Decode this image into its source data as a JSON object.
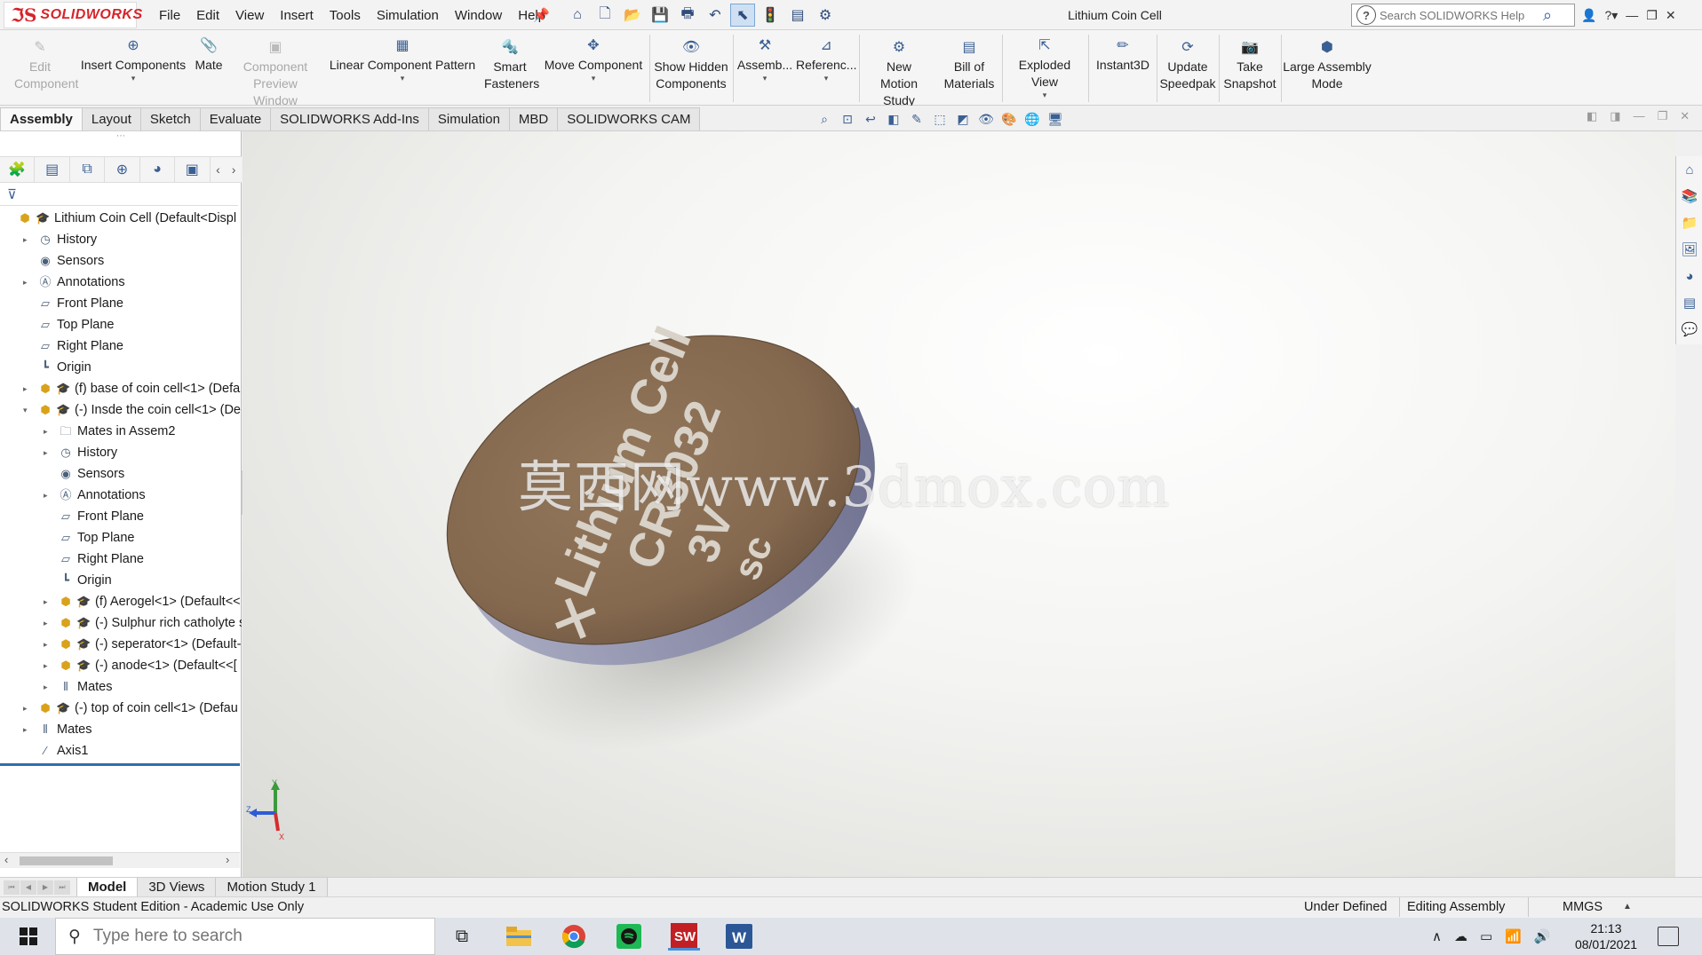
{
  "app": {
    "brand": "SOLIDWORKS",
    "document_title": "Lithium Coin Cell",
    "menu": [
      "File",
      "Edit",
      "View",
      "Insert",
      "Tools",
      "Simulation",
      "Window",
      "Help"
    ],
    "search_placeholder": "Search SOLIDWORKS Help"
  },
  "commands": {
    "edit_component": "Edit Component",
    "insert_components": "Insert Components",
    "mate": "Mate",
    "component_preview": "Component Preview Window",
    "linear_pattern": "Linear Component Pattern",
    "smart_fasteners": "Smart Fasteners",
    "move_component": "Move Component",
    "show_hidden": "Show Hidden Components",
    "assembly": "Assemb...",
    "reference": "Referenc...",
    "new_motion": "New Motion Study",
    "bom": "Bill of Materials",
    "exploded": "Exploded View",
    "instant3d": "Instant3D",
    "speedpak": "Update Speedpak",
    "snapshot": "Take Snapshot",
    "large_assembly": "Large Assembly Mode"
  },
  "tabs": [
    "Assembly",
    "Layout",
    "Sketch",
    "Evaluate",
    "SOLIDWORKS Add-Ins",
    "Simulation",
    "MBD",
    "SOLIDWORKS CAM"
  ],
  "active_tab": "Assembly",
  "tree": [
    {
      "label": "Lithium Coin Cell  (Default<Displ",
      "indent": 0,
      "icon": "assembly-icon",
      "expand": ""
    },
    {
      "label": "History",
      "indent": 1,
      "icon": "history-icon",
      "expand": "▸"
    },
    {
      "label": "Sensors",
      "indent": 1,
      "icon": "sensors-icon",
      "expand": ""
    },
    {
      "label": "Annotations",
      "indent": 1,
      "icon": "annotations-icon",
      "expand": "▸"
    },
    {
      "label": "Front Plane",
      "indent": 1,
      "icon": "plane-icon",
      "expand": ""
    },
    {
      "label": "Top Plane",
      "indent": 1,
      "icon": "plane-icon",
      "expand": ""
    },
    {
      "label": "Right Plane",
      "indent": 1,
      "icon": "plane-icon",
      "expand": ""
    },
    {
      "label": "Origin",
      "indent": 1,
      "icon": "origin-icon",
      "expand": ""
    },
    {
      "label": "(f) base of coin cell<1> (Defa",
      "indent": 1,
      "icon": "component-icon",
      "expand": "▸"
    },
    {
      "label": "(-) Insde the coin cell<1> (De",
      "indent": 1,
      "icon": "component-icon",
      "expand": "▾"
    },
    {
      "label": "Mates in Assem2",
      "indent": 2,
      "icon": "mates-folder-icon",
      "expand": "▸"
    },
    {
      "label": "History",
      "indent": 2,
      "icon": "history-icon",
      "expand": "▸"
    },
    {
      "label": "Sensors",
      "indent": 2,
      "icon": "sensors-icon",
      "expand": ""
    },
    {
      "label": "Annotations",
      "indent": 2,
      "icon": "annotations-icon",
      "expand": "▸"
    },
    {
      "label": "Front Plane",
      "indent": 2,
      "icon": "plane-icon",
      "expand": ""
    },
    {
      "label": "Top Plane",
      "indent": 2,
      "icon": "plane-icon",
      "expand": ""
    },
    {
      "label": "Right Plane",
      "indent": 2,
      "icon": "plane-icon",
      "expand": ""
    },
    {
      "label": "Origin",
      "indent": 2,
      "icon": "origin-icon",
      "expand": ""
    },
    {
      "label": "(f) Aerogel<1> (Default<<",
      "indent": 2,
      "icon": "component-icon",
      "expand": "▸"
    },
    {
      "label": "(-) Sulphur rich catholyte s",
      "indent": 2,
      "icon": "component-icon",
      "expand": "▸"
    },
    {
      "label": "(-) seperator<1> (Default-",
      "indent": 2,
      "icon": "component-icon",
      "expand": "▸"
    },
    {
      "label": "(-) anode<1> (Default<<[",
      "indent": 2,
      "icon": "component-icon",
      "expand": "▸"
    },
    {
      "label": "Mates",
      "indent": 2,
      "icon": "mates-icon",
      "expand": "▸"
    },
    {
      "label": "(-) top of coin cell<1> (Defau",
      "indent": 1,
      "icon": "component-icon",
      "expand": "▸"
    },
    {
      "label": "Mates",
      "indent": 1,
      "icon": "mates-icon",
      "expand": "▸"
    },
    {
      "label": "Axis1",
      "indent": 1,
      "icon": "axis-icon",
      "expand": ""
    }
  ],
  "model": {
    "coin_text": [
      "Lithium Cell",
      "CR3032",
      "3V",
      "sc"
    ],
    "coin_plus": "+",
    "triad": {
      "y": "Y",
      "z": "Z",
      "x": "X"
    }
  },
  "watermark": "莫西网www.3dmox.com",
  "bottom_tabs": [
    "Model",
    "3D Views",
    "Motion Study 1"
  ],
  "active_bottom_tab": "Model",
  "status": {
    "edition": "SOLIDWORKS Student Edition - Academic Use Only",
    "definition": "Under Defined",
    "mode": "Editing Assembly",
    "units": "MMGS"
  },
  "taskbar": {
    "search_placeholder": "Type here to search",
    "time": "21:13",
    "date": "08/01/2021"
  },
  "colors": {
    "brand_red": "#d6242a",
    "accent_blue": "#2e6db4",
    "coin_face": "#8a6f55",
    "coin_edge": "#8d8ea8"
  }
}
